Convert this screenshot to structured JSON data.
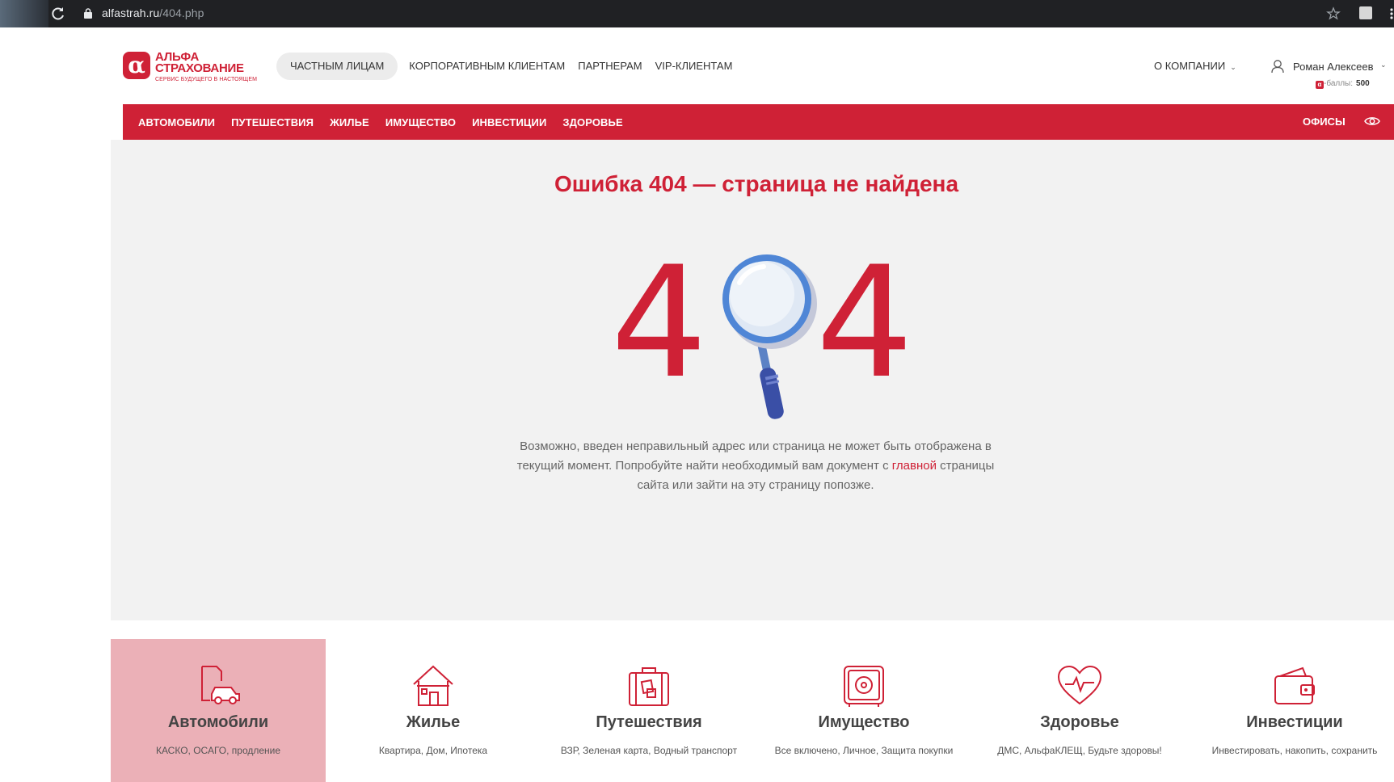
{
  "browser": {
    "url_host": "alfastrah.ru",
    "url_path": "/404.php"
  },
  "logo": {
    "line1": "АЛЬФА",
    "line2": "СТРАХОВАНИЕ",
    "tagline": "СЕРВИС БУДУЩЕГО В НАСТОЯЩЕМ"
  },
  "top_nav": [
    {
      "label": "ЧАСТНЫМ ЛИЦАМ",
      "active": true
    },
    {
      "label": "КОРПОРАТИВНЫМ КЛИЕНТАМ"
    },
    {
      "label": "ПАРТНЕРАМ"
    },
    {
      "label": "VIP-КЛИЕНТАМ"
    }
  ],
  "about": "О КОМПАНИИ",
  "user": {
    "name": "Роман Алексеев",
    "points_prefix": "-баллы:",
    "points_value": "500"
  },
  "categories": [
    "АВТОМОБИЛИ",
    "ПУТЕШЕСТВИЯ",
    "ЖИЛЬЕ",
    "ИМУЩЕСТВО",
    "ИНВЕСТИЦИИ",
    "ЗДОРОВЬЕ"
  ],
  "offices": "ОФИСЫ",
  "error": {
    "title": "Ошибка 404 — страница не найдена",
    "text_before": "Возможно, введен неправильный адрес или страница не может быть отображена в текущий момент. Попробуйте найти необходимый вам документ с ",
    "link": "главной",
    "text_after": " страницы сайта или зайти на эту страницу попозже.",
    "digit_left": "4",
    "digit_right": "4"
  },
  "cards": [
    {
      "title": "Автомобили",
      "sub": "КАСКО, ОСАГО, продление",
      "icon": "car-document-icon",
      "active": true
    },
    {
      "title": "Жилье",
      "sub": "Квартира, Дом, Ипотека",
      "icon": "house-icon"
    },
    {
      "title": "Путешествия",
      "sub": "ВЗР, Зеленая карта, Водный транспорт",
      "icon": "suitcase-icon"
    },
    {
      "title": "Имущество",
      "sub": "Все включено, Личное, Защита покупки",
      "icon": "safe-icon"
    },
    {
      "title": "Здоровье",
      "sub": "ДМС, АльфаКЛЕЩ, Будьте здоровы!",
      "icon": "heart-pulse-icon"
    },
    {
      "title": "Инвестиции",
      "sub": "Инвестировать, накопить, сохранить",
      "icon": "wallet-icon"
    }
  ],
  "colors": {
    "brand_red": "#cf2136",
    "card_active_bg": "#ebb0b7",
    "content_bg": "#f2f2f2"
  }
}
